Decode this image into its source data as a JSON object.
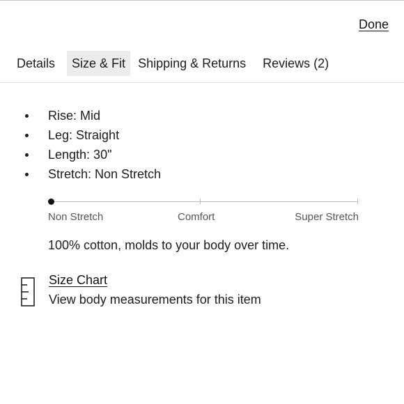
{
  "header": {
    "done_label": "Done"
  },
  "tabs": [
    {
      "label": "Details",
      "active": false
    },
    {
      "label": "Size & Fit",
      "active": true
    },
    {
      "label": "Shipping & Returns",
      "active": false
    },
    {
      "label": "Reviews (2)",
      "active": false
    }
  ],
  "specs": [
    "Rise: Mid",
    "Leg: Straight",
    "Length: 30\"",
    "Stretch: Non Stretch"
  ],
  "stretch_scale": {
    "labels": [
      "Non Stretch",
      "Comfort",
      "Super Stretch"
    ],
    "selected": "Non Stretch",
    "level": 0
  },
  "material": "100% cotton, molds to your body over time.",
  "size_chart": {
    "link_label": "Size Chart",
    "description": "View body measurements for this item",
    "icon": "ruler-icon"
  }
}
